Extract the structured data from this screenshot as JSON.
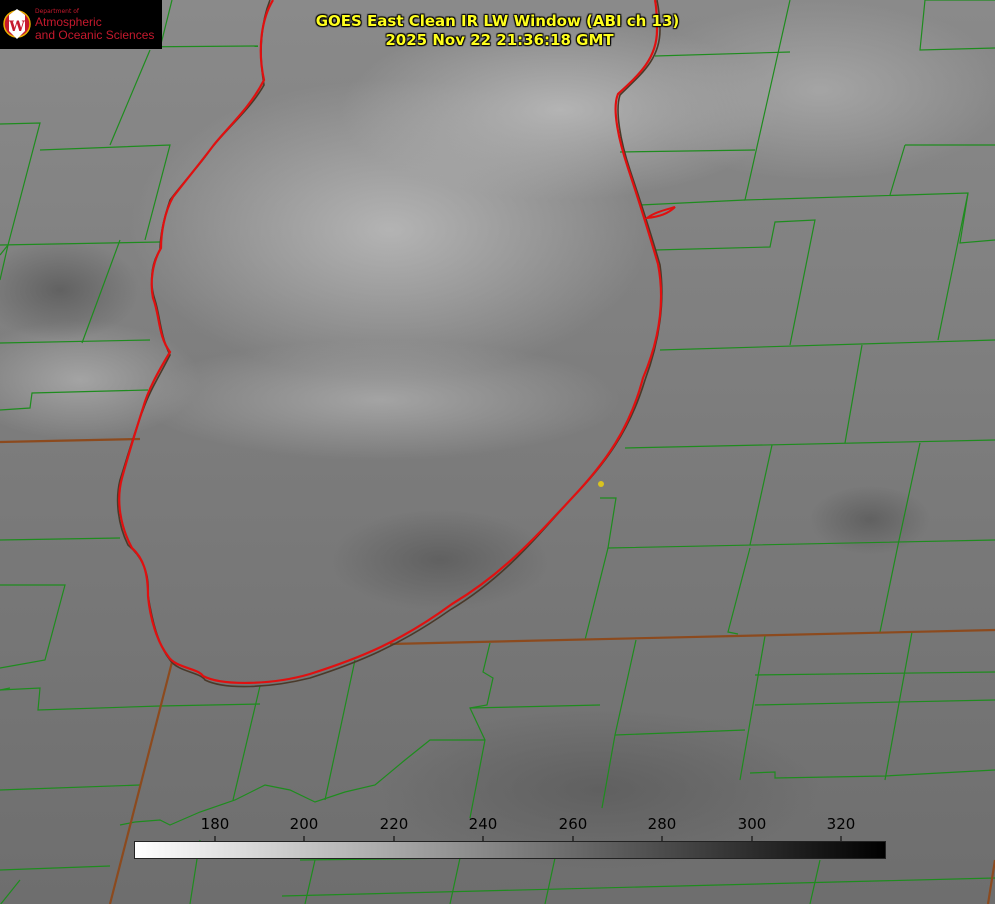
{
  "header": {
    "title": "GOES East Clean IR LW Window (ABI ch 13)",
    "timestamp": "2025 Nov 22 21:36:18 GMT"
  },
  "logo": {
    "department": "Department of",
    "line1": "Atmospheric",
    "line2": "and Oceanic Sciences",
    "seal_letter": "W",
    "colors": {
      "background": "#000000",
      "text": "#c5192d",
      "seal": "#c5192d"
    }
  },
  "colorbar": {
    "ticks": [
      "180",
      "200",
      "220",
      "240",
      "260",
      "280",
      "300",
      "320"
    ],
    "gradient": {
      "from": "#ffffff",
      "to": "#000000"
    }
  },
  "map": {
    "colors": {
      "county_lines": "#1e8c1e",
      "state_lines": "#8c4a1e",
      "lake_outline": "#e01010",
      "title_text": "#ffff1e",
      "site_marker": "#d8c320"
    }
  }
}
